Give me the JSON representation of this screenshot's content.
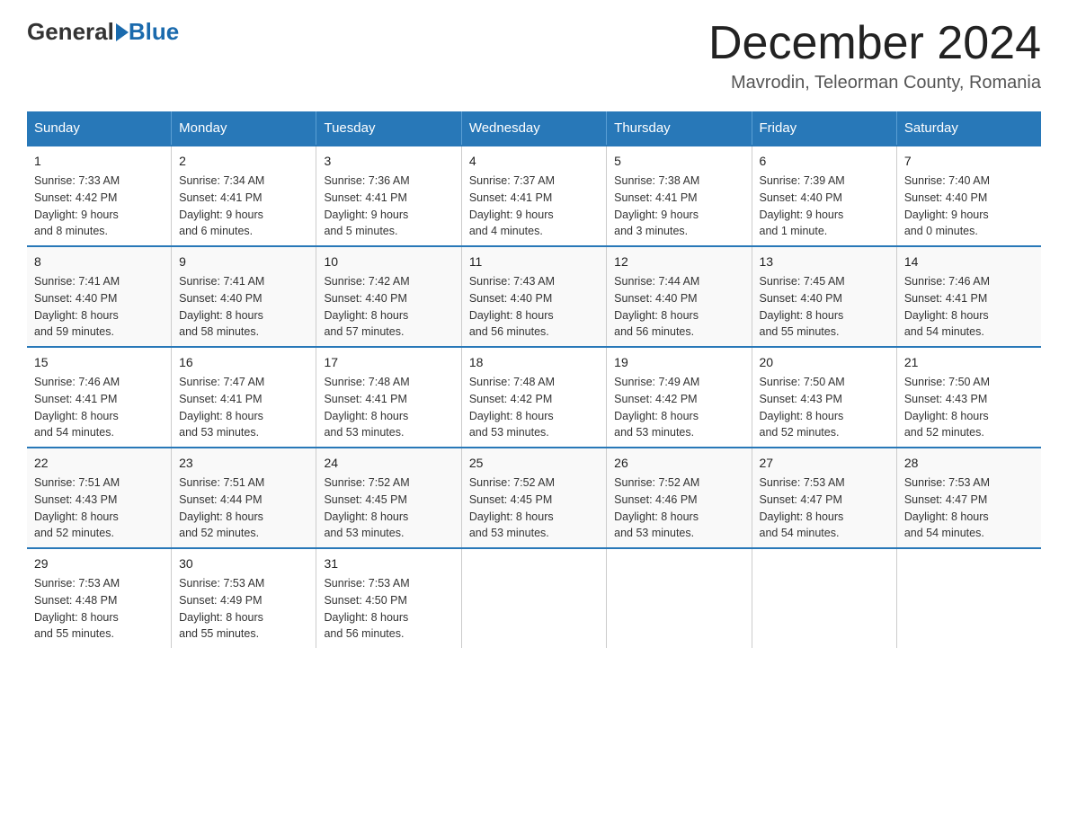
{
  "header": {
    "logo_general": "General",
    "logo_blue": "Blue",
    "month_title": "December 2024",
    "location": "Mavrodin, Teleorman County, Romania"
  },
  "days_of_week": [
    "Sunday",
    "Monday",
    "Tuesday",
    "Wednesday",
    "Thursday",
    "Friday",
    "Saturday"
  ],
  "weeks": [
    [
      {
        "day": "1",
        "sunrise": "7:33 AM",
        "sunset": "4:42 PM",
        "daylight": "9 hours and 8 minutes."
      },
      {
        "day": "2",
        "sunrise": "7:34 AM",
        "sunset": "4:41 PM",
        "daylight": "9 hours and 6 minutes."
      },
      {
        "day": "3",
        "sunrise": "7:36 AM",
        "sunset": "4:41 PM",
        "daylight": "9 hours and 5 minutes."
      },
      {
        "day": "4",
        "sunrise": "7:37 AM",
        "sunset": "4:41 PM",
        "daylight": "9 hours and 4 minutes."
      },
      {
        "day": "5",
        "sunrise": "7:38 AM",
        "sunset": "4:41 PM",
        "daylight": "9 hours and 3 minutes."
      },
      {
        "day": "6",
        "sunrise": "7:39 AM",
        "sunset": "4:40 PM",
        "daylight": "9 hours and 1 minute."
      },
      {
        "day": "7",
        "sunrise": "7:40 AM",
        "sunset": "4:40 PM",
        "daylight": "9 hours and 0 minutes."
      }
    ],
    [
      {
        "day": "8",
        "sunrise": "7:41 AM",
        "sunset": "4:40 PM",
        "daylight": "8 hours and 59 minutes."
      },
      {
        "day": "9",
        "sunrise": "7:41 AM",
        "sunset": "4:40 PM",
        "daylight": "8 hours and 58 minutes."
      },
      {
        "day": "10",
        "sunrise": "7:42 AM",
        "sunset": "4:40 PM",
        "daylight": "8 hours and 57 minutes."
      },
      {
        "day": "11",
        "sunrise": "7:43 AM",
        "sunset": "4:40 PM",
        "daylight": "8 hours and 56 minutes."
      },
      {
        "day": "12",
        "sunrise": "7:44 AM",
        "sunset": "4:40 PM",
        "daylight": "8 hours and 56 minutes."
      },
      {
        "day": "13",
        "sunrise": "7:45 AM",
        "sunset": "4:40 PM",
        "daylight": "8 hours and 55 minutes."
      },
      {
        "day": "14",
        "sunrise": "7:46 AM",
        "sunset": "4:41 PM",
        "daylight": "8 hours and 54 minutes."
      }
    ],
    [
      {
        "day": "15",
        "sunrise": "7:46 AM",
        "sunset": "4:41 PM",
        "daylight": "8 hours and 54 minutes."
      },
      {
        "day": "16",
        "sunrise": "7:47 AM",
        "sunset": "4:41 PM",
        "daylight": "8 hours and 53 minutes."
      },
      {
        "day": "17",
        "sunrise": "7:48 AM",
        "sunset": "4:41 PM",
        "daylight": "8 hours and 53 minutes."
      },
      {
        "day": "18",
        "sunrise": "7:48 AM",
        "sunset": "4:42 PM",
        "daylight": "8 hours and 53 minutes."
      },
      {
        "day": "19",
        "sunrise": "7:49 AM",
        "sunset": "4:42 PM",
        "daylight": "8 hours and 53 minutes."
      },
      {
        "day": "20",
        "sunrise": "7:50 AM",
        "sunset": "4:43 PM",
        "daylight": "8 hours and 52 minutes."
      },
      {
        "day": "21",
        "sunrise": "7:50 AM",
        "sunset": "4:43 PM",
        "daylight": "8 hours and 52 minutes."
      }
    ],
    [
      {
        "day": "22",
        "sunrise": "7:51 AM",
        "sunset": "4:43 PM",
        "daylight": "8 hours and 52 minutes."
      },
      {
        "day": "23",
        "sunrise": "7:51 AM",
        "sunset": "4:44 PM",
        "daylight": "8 hours and 52 minutes."
      },
      {
        "day": "24",
        "sunrise": "7:52 AM",
        "sunset": "4:45 PM",
        "daylight": "8 hours and 53 minutes."
      },
      {
        "day": "25",
        "sunrise": "7:52 AM",
        "sunset": "4:45 PM",
        "daylight": "8 hours and 53 minutes."
      },
      {
        "day": "26",
        "sunrise": "7:52 AM",
        "sunset": "4:46 PM",
        "daylight": "8 hours and 53 minutes."
      },
      {
        "day": "27",
        "sunrise": "7:53 AM",
        "sunset": "4:47 PM",
        "daylight": "8 hours and 54 minutes."
      },
      {
        "day": "28",
        "sunrise": "7:53 AM",
        "sunset": "4:47 PM",
        "daylight": "8 hours and 54 minutes."
      }
    ],
    [
      {
        "day": "29",
        "sunrise": "7:53 AM",
        "sunset": "4:48 PM",
        "daylight": "8 hours and 55 minutes."
      },
      {
        "day": "30",
        "sunrise": "7:53 AM",
        "sunset": "4:49 PM",
        "daylight": "8 hours and 55 minutes."
      },
      {
        "day": "31",
        "sunrise": "7:53 AM",
        "sunset": "4:50 PM",
        "daylight": "8 hours and 56 minutes."
      },
      {
        "day": "",
        "sunrise": "",
        "sunset": "",
        "daylight": ""
      },
      {
        "day": "",
        "sunrise": "",
        "sunset": "",
        "daylight": ""
      },
      {
        "day": "",
        "sunrise": "",
        "sunset": "",
        "daylight": ""
      },
      {
        "day": "",
        "sunrise": "",
        "sunset": "",
        "daylight": ""
      }
    ]
  ],
  "labels": {
    "sunrise": "Sunrise:",
    "sunset": "Sunset:",
    "daylight": "Daylight:"
  }
}
